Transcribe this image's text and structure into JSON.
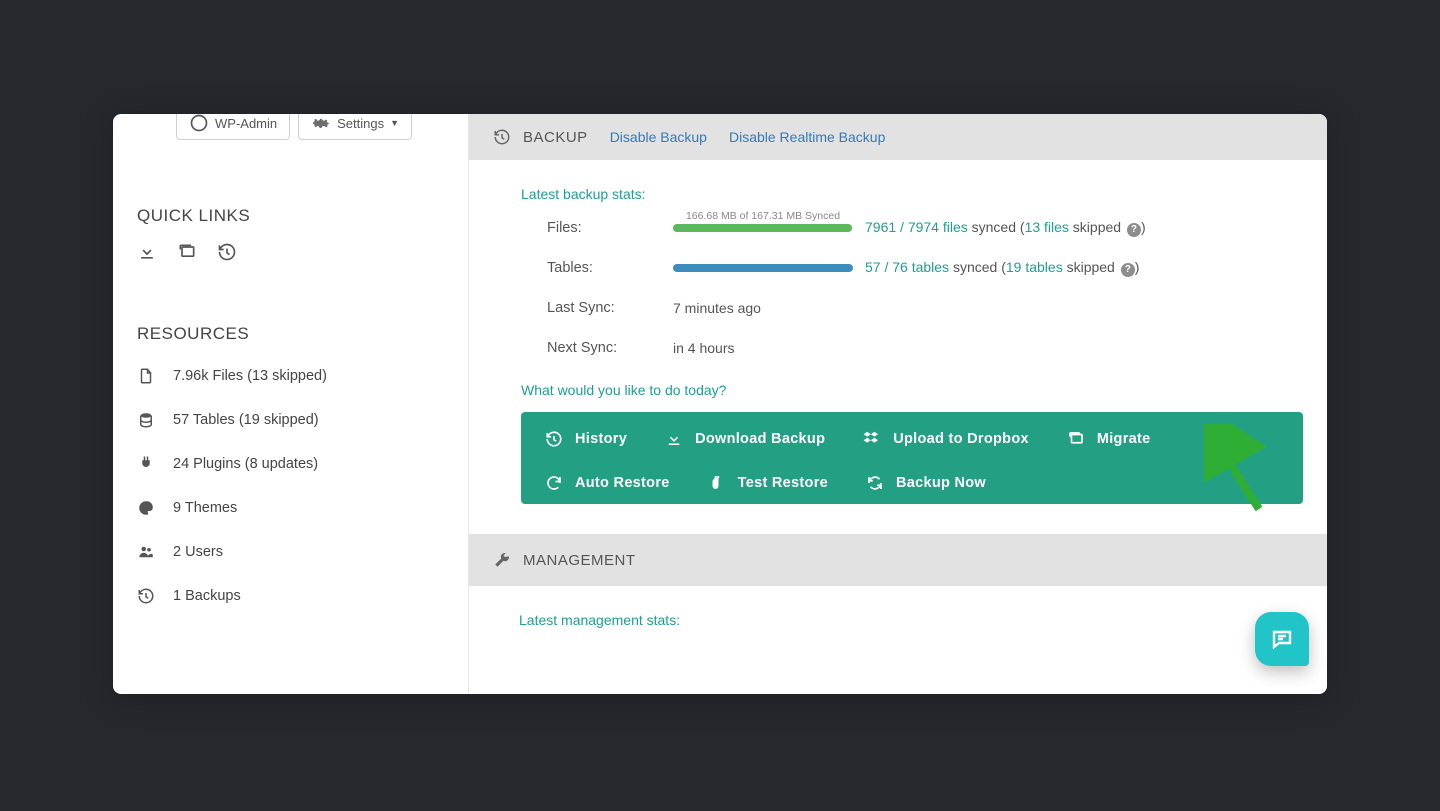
{
  "topbar": {
    "wpadmin_label": "WP-Admin",
    "settings_label": "Settings"
  },
  "sidebar": {
    "ql_heading": "QUICK LINKS",
    "res_heading": "RESOURCES",
    "resources": [
      {
        "label": "7.96k Files (13 skipped)"
      },
      {
        "label": "57 Tables (19 skipped)"
      },
      {
        "label": "24 Plugins (8 updates)"
      },
      {
        "label": "9 Themes"
      },
      {
        "label": "2 Users"
      },
      {
        "label": "1 Backups"
      }
    ]
  },
  "backup": {
    "section_title": "BACKUP",
    "disable_label": "Disable Backup",
    "disable_rt_label": "Disable Realtime Backup",
    "latest_stats_label": "Latest backup stats:",
    "files_label": "Files:",
    "files_bar_caption": "166.68 MB of 167.31 MB Synced",
    "files_text_a": "7961 / 7974 files",
    "files_text_b": " synced (",
    "files_text_c": "13 files",
    "files_text_d": " skipped ",
    "files_text_end": ")",
    "tables_label": "Tables:",
    "tables_text_a": "57 / 76 tables",
    "tables_text_b": " synced (",
    "tables_text_c": "19 tables",
    "tables_text_d": " skipped ",
    "tables_text_end": ")",
    "last_sync_label": "Last Sync:",
    "last_sync_value": "7 minutes ago",
    "next_sync_label": "Next Sync:",
    "next_sync_value": "in 4 hours",
    "prompt": "What would you like to do today?",
    "actions": [
      {
        "label": "History"
      },
      {
        "label": "Download Backup"
      },
      {
        "label": "Upload to Dropbox"
      },
      {
        "label": "Migrate"
      },
      {
        "label": "Auto Restore"
      },
      {
        "label": "Test Restore"
      },
      {
        "label": "Backup Now"
      }
    ]
  },
  "management": {
    "section_title": "MANAGEMENT",
    "latest_stats_label": "Latest management stats:"
  },
  "colors": {
    "files_bar": "#5cb85c",
    "tables_bar": "#3c8dbc"
  },
  "progress": {
    "files_pct": 99.6,
    "tables_pct": 100
  }
}
